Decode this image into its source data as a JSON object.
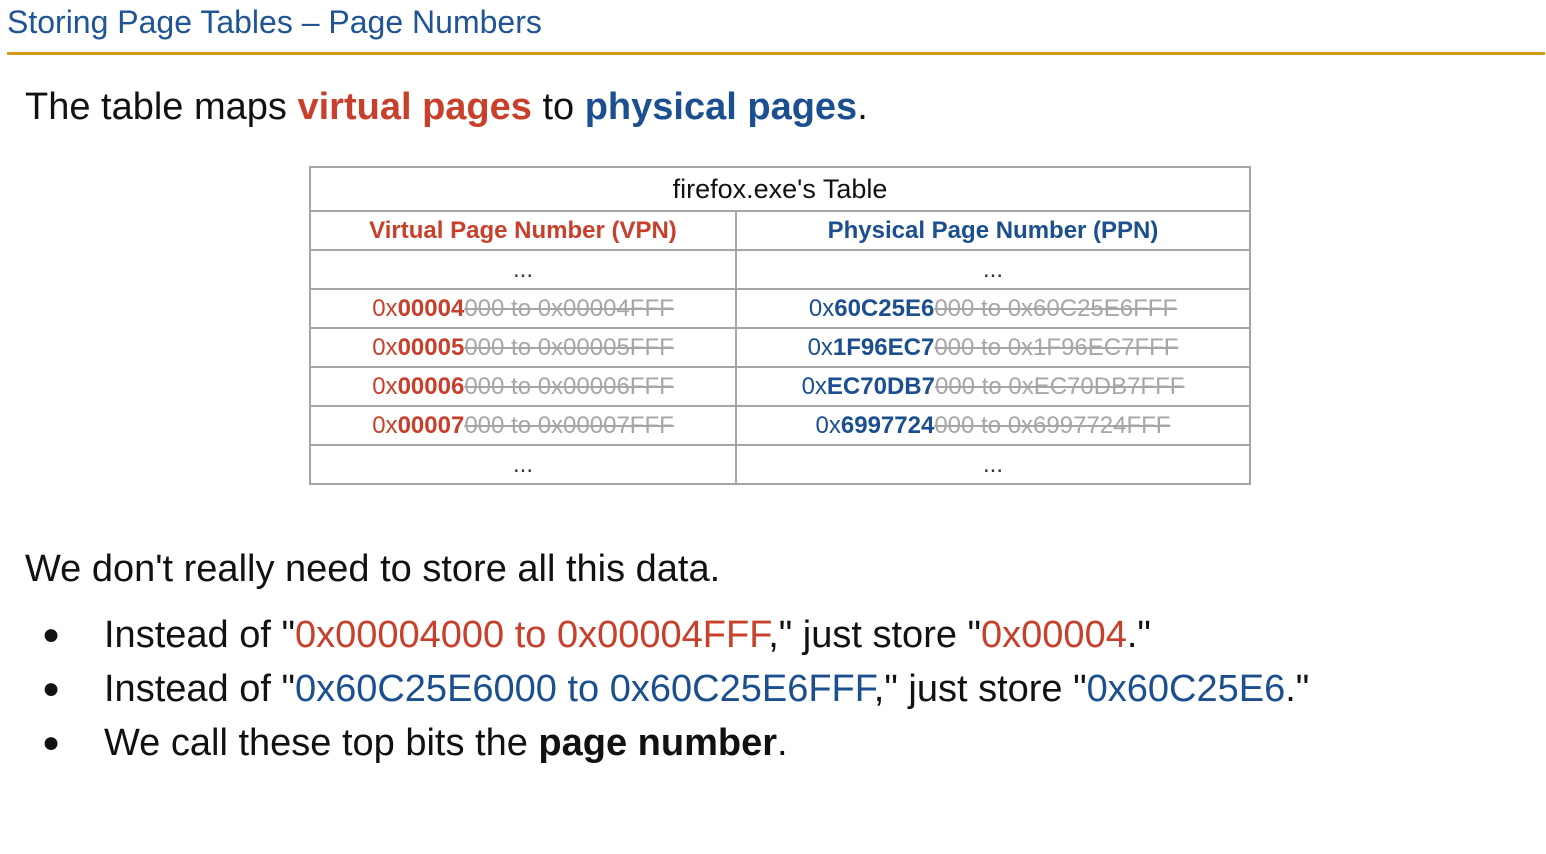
{
  "slide": {
    "title": "Storing Page Tables – Page Numbers"
  },
  "intro": {
    "pre": "The table maps ",
    "virtual": "virtual pages",
    "mid": " to ",
    "physical": "physical pages",
    "post": "."
  },
  "table": {
    "caption": "firefox.exe's Table",
    "headers": {
      "vpn": "Virtual Page Number (VPN)",
      "ppn": "Physical Page Number (PPN)"
    },
    "ellipsis": "...",
    "rows": [
      {
        "vpn": {
          "prefix": "0x",
          "num": "00004",
          "rest": "000 to 0x00004FFF"
        },
        "ppn": {
          "prefix": "0x",
          "num": "60C25E6",
          "rest": "000 to 0x60C25E6FFF"
        }
      },
      {
        "vpn": {
          "prefix": "0x",
          "num": "00005",
          "rest": "000 to 0x00005FFF"
        },
        "ppn": {
          "prefix": "0x",
          "num": "1F96EC7",
          "rest": "000 to 0x1F96EC7FFF"
        }
      },
      {
        "vpn": {
          "prefix": "0x",
          "num": "00006",
          "rest": "000 to 0x00006FFF"
        },
        "ppn": {
          "prefix": "0x",
          "num": "EC70DB7",
          "rest": "000 to 0xEC70DB7FFF"
        }
      },
      {
        "vpn": {
          "prefix": "0x",
          "num": "00007",
          "rest": "000 to 0x00007FFF"
        },
        "ppn": {
          "prefix": "0x",
          "num": "6997724",
          "rest": "000 to 0x6997724FFF"
        }
      }
    ]
  },
  "paragraph": "We don't really need to store all this data.",
  "bullets": {
    "dot": "●",
    "b1": {
      "pre": "Instead of \"",
      "range": "0x00004000 to 0x00004FFF",
      "mid": ",\" just store \"",
      "value": "0x00004",
      "post": ".\""
    },
    "b2": {
      "pre": "Instead of \"",
      "range": "0x60C25E6000 to 0x60C25E6FFF",
      "mid": ",\" just store \"",
      "value": "0x60C25E6",
      "post": ".\""
    },
    "b3": {
      "pre": "We call these top bits the ",
      "bold": "page number",
      "post": "."
    }
  },
  "colors": {
    "title": "#1f5496",
    "rule": "#d49a1a",
    "virtual": "#c8402b",
    "physical": "#1b4f8f",
    "struck": "#a6a6a6"
  }
}
